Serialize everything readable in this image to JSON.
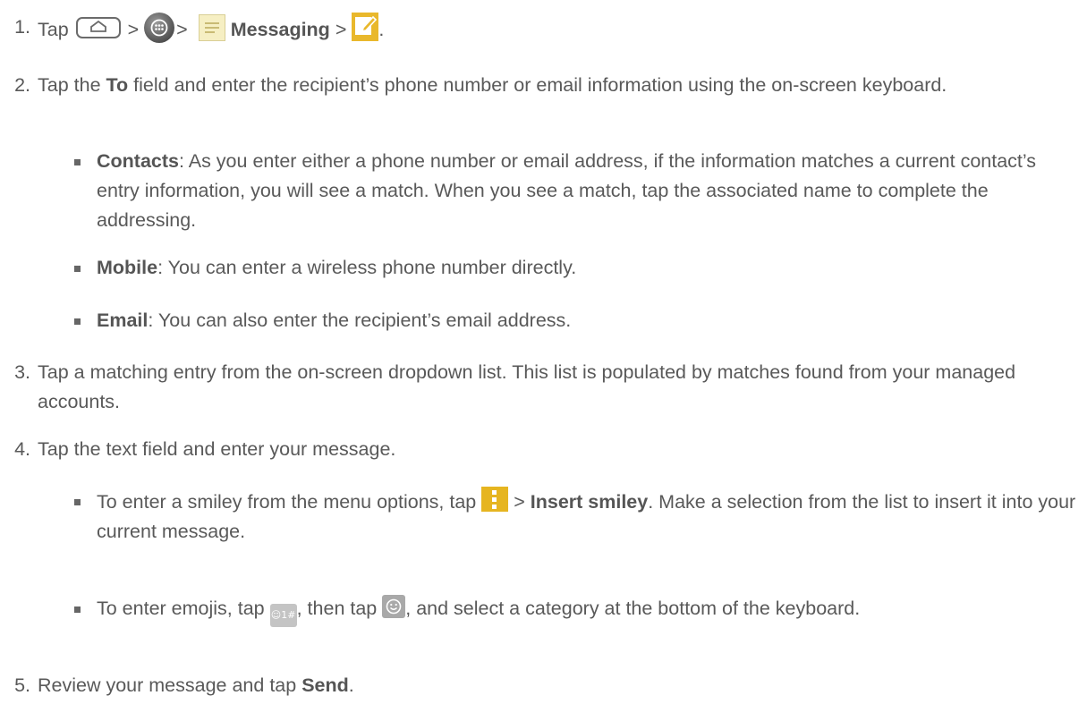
{
  "steps": [
    {
      "num": "1.",
      "tap": "Tap",
      "sep1": ">",
      "sep2": ">",
      "messaging": "Messaging",
      "sep3": ">",
      "end": ".",
      "icons": [
        "home-button",
        "apps-icon",
        "messaging-icon",
        "compose-icon"
      ]
    },
    {
      "num": "2.",
      "pre": "Tap the",
      "bold": "To",
      "post": "field and enter the recipient’s phone number or email information using the on-screen keyboard.",
      "bullets": [
        {
          "bold": "Contacts",
          "text": ": As you enter either a phone number or email address, if the information matches a current contact’s entry information, you will see a match. When you see a match, tap the associated name to complete the addressing."
        },
        {
          "bold": "Mobile",
          "text": ": You can enter a wireless phone number directly."
        },
        {
          "bold": "Email",
          "text": ": You can also enter the recipient’s email address."
        }
      ]
    },
    {
      "num": "3.",
      "text": "Tap a matching entry from the on-screen dropdown list. This list is populated by matches found from your managed accounts."
    },
    {
      "num": "4.",
      "text": "Tap the text field and enter your message.",
      "bullets": [
        {
          "pre": "To enter a smiley from the menu options, tap",
          "sep": ">",
          "bold": "Insert smiley",
          "post": ". Make a selection from the list to insert it into your current message.",
          "icon": "menu-icon"
        },
        {
          "pre": "To enter emojis, tap",
          "emoji_key": "☺1#",
          "mid": ", then tap",
          "post": ", and select a category at the bottom of the keyboard.",
          "icons": [
            "emoji-key-icon",
            "smiley-key-icon"
          ]
        }
      ]
    },
    {
      "num": "5.",
      "pre": "Review your message and tap",
      "bold": "Send",
      "post": "."
    }
  ],
  "colors": {
    "text": "#595959",
    "compose_icon": "#e9b82c",
    "menu_icon": "#e6b520",
    "messaging_icon": "#f6efc3"
  }
}
